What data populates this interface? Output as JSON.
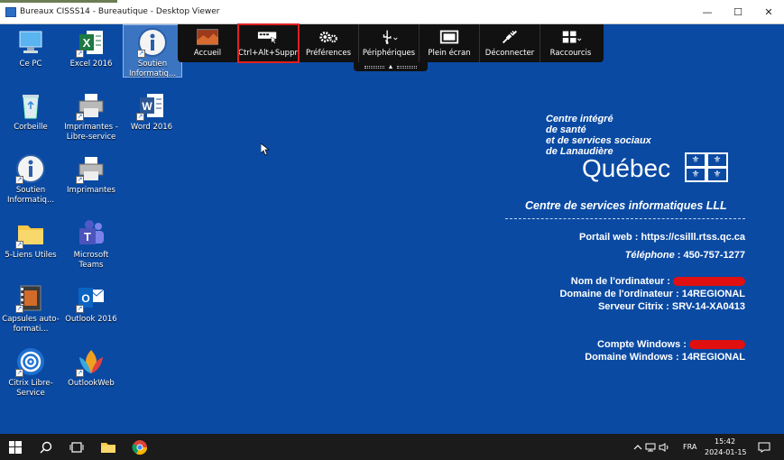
{
  "window": {
    "title": "Bureaux CISSS14 - Bureautique - Desktop Viewer",
    "minimize_glyph": "—",
    "maximize_glyph": "☐",
    "close_glyph": "✕"
  },
  "desktop_icons": [
    {
      "label": "Ce PC",
      "icon": "computer-icon"
    },
    {
      "label": "Excel 2016",
      "icon": "excel-icon"
    },
    {
      "label": "Soutien Informatiq...",
      "icon": "info-icon"
    },
    {
      "label": "Corbeille",
      "icon": "recycle-bin-icon"
    },
    {
      "label": "Imprimantes - Libre-service",
      "icon": "printer-icon"
    },
    {
      "label": "Word 2016",
      "icon": "word-icon"
    },
    {
      "label": "Soutien Informatiq...",
      "icon": "info-icon"
    },
    {
      "label": "Imprimantes",
      "icon": "printer-icon"
    },
    {
      "label": "5-Liens Utiles",
      "icon": "folder-icon"
    },
    {
      "label": "Microsoft Teams",
      "icon": "teams-icon"
    },
    {
      "label": "Capsules auto-formati...",
      "icon": "video-icon"
    },
    {
      "label": "Outlook 2016",
      "icon": "outlook-icon"
    },
    {
      "label": "Citrix Libre-Service",
      "icon": "citrix-icon"
    },
    {
      "label": "OutlookWeb",
      "icon": "outlookweb-icon"
    }
  ],
  "toolbar": {
    "home": "Accueil",
    "ctrl_alt_del": "Ctrl+Alt+Suppr",
    "preferences": "Préférences",
    "devices": "Périphériques",
    "fullscreen": "Plein écran",
    "disconnect": "Déconnecter",
    "shortcuts": "Raccourcis",
    "handle_arrow": "▲",
    "highlight_color": "#e02020"
  },
  "org": {
    "line1": "Centre intégré",
    "line2": "de santé",
    "line3": "et de services sociaux",
    "line4": "de Lanaudière",
    "quebec": "Québec",
    "center": "Centre de services informatiques LLL"
  },
  "info": {
    "portal_label": "Portail web : ",
    "portal_value": "https://csilll.rtss.qc.ca",
    "phone_label": "Téléphone",
    "phone_value": " : 450-757-1277",
    "computer_label": "Nom de l'ordinateur : ",
    "domain_label": "Domaine de l'ordinateur : ",
    "domain_value": "14REGIONAL",
    "citrix_label": "Serveur Citrix : ",
    "citrix_value": "SRV-14-XA0413",
    "account_label": "Compte Windows : ",
    "win_domain_label": "Domaine Windows : ",
    "win_domain_value": "14REGIONAL"
  },
  "taskbar": {
    "language": "FRA",
    "time": "15:42",
    "date": "2024-01-15"
  },
  "colors": {
    "desktop": "#0a4aa3",
    "toolbar": "#111111",
    "taskbar": "#1b1b1b",
    "redaction": "#e01010"
  }
}
